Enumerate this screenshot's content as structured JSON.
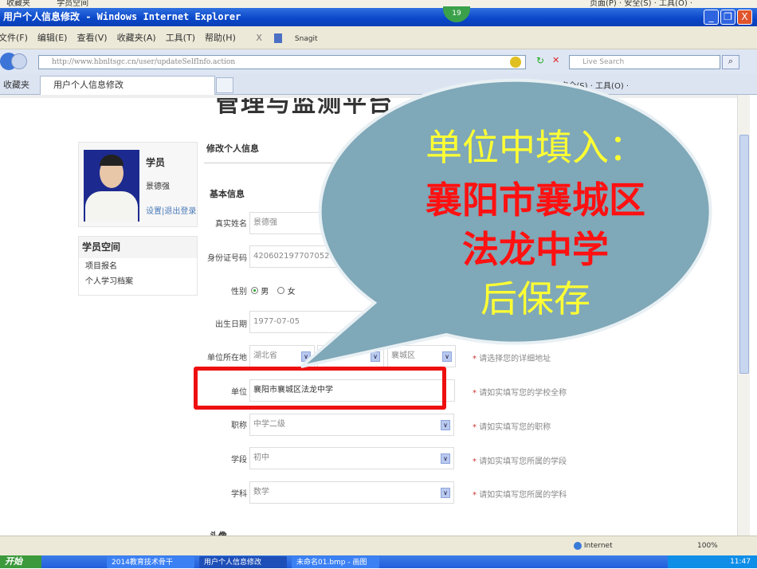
{
  "prev_window": {
    "favorites": "收藏夹",
    "tab": "学员空间",
    "right": "页面(P) · 安全(S) · 工具(O) ·"
  },
  "window": {
    "title": "用户个人信息修改 - Windows Internet Explorer",
    "badge": "19",
    "minimize": "_",
    "restore": "❐",
    "close": "X"
  },
  "menu": [
    "文件(F)",
    "编辑(E)",
    "查看(V)",
    "收藏夹(A)",
    "工具(T)",
    "帮助(H)"
  ],
  "menu_extra": {
    "x": "X",
    "snagit": "Snagit"
  },
  "address": {
    "url": "http://www.hbnltsgc.cn/user/updateSelfInfo.action",
    "search_placeholder": "Live Search"
  },
  "tabs": {
    "favorites": "收藏夹",
    "active": "用户个人信息修改",
    "tools": "页面(P) · 安全(S) · 工具(O) ·"
  },
  "banner": "管理与监测平台",
  "user": {
    "role": "学员",
    "name": "景德强",
    "settings": "设置",
    "sep": "|",
    "logout": "退出登录"
  },
  "sidebar": {
    "title": "学员空间",
    "items": [
      "项目报名",
      "个人学习档案"
    ]
  },
  "main": {
    "title": "修改个人信息",
    "section": "基本信息"
  },
  "form": {
    "real_name": {
      "label": "真实姓名",
      "value": "景德强"
    },
    "id_number": {
      "label": "身份证号码",
      "value": "420602197707052011"
    },
    "gender": {
      "label": "性别",
      "options": [
        "男",
        "女"
      ],
      "selected": "男"
    },
    "birth": {
      "label": "出生日期",
      "value": "1977-07-05"
    },
    "location": {
      "label": "单位所在地",
      "province": "湖北省",
      "city": "襄阳市",
      "district": "襄城区",
      "hint": "请选择您的详细地址"
    },
    "unit": {
      "label": "单位",
      "value": "襄阳市襄城区法龙中学",
      "hint": "请如实填写您的学校全称"
    },
    "title": {
      "label": "职称",
      "value": "中学二级",
      "hint": "请如实填写您的职称"
    },
    "stage": {
      "label": "学段",
      "value": "初中",
      "hint": "请如实填写您所属的学段"
    },
    "subject": {
      "label": "学科",
      "value": "数学",
      "hint": "请如实填写您所属的学科"
    },
    "required_mark": "*",
    "next_section_partial": "头像"
  },
  "callout": {
    "line1": "单位中填入：",
    "line2": "襄阳市襄城区",
    "line3": "法龙中学",
    "line4": "后保存",
    "yellow": "#ffff33",
    "red": "#ff1111",
    "fill": "#7fa8b8"
  },
  "status": {
    "zone": "Internet",
    "zoom": "100%"
  },
  "taskbar": {
    "start": "开始",
    "items": [
      "2014教育技术骨干",
      "用户个人信息修改",
      "未命名01.bmp - 画图"
    ],
    "clock": "11:47"
  }
}
